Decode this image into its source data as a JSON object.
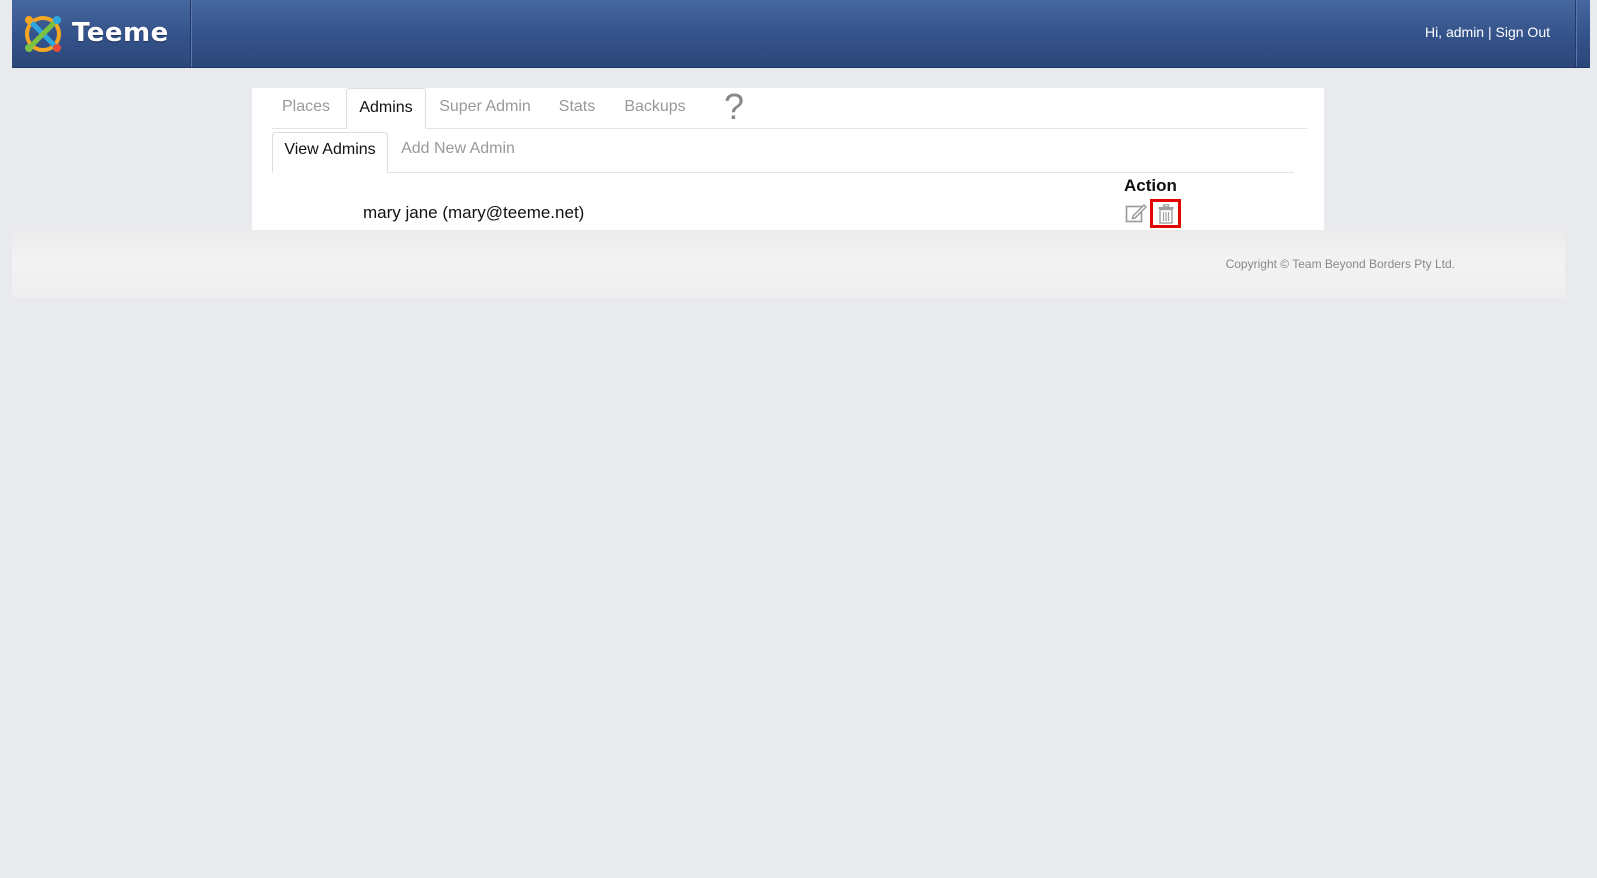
{
  "header": {
    "app_name": "Teeme",
    "greeting": "Hi, admin",
    "separator": "|",
    "sign_out": "Sign Out",
    "colors": {
      "header_bg": "#34528a",
      "header_text": "#ffffff"
    }
  },
  "main_tabs": [
    {
      "label": "Places",
      "active": false
    },
    {
      "label": "Admins",
      "active": true
    },
    {
      "label": "Super Admin",
      "active": false
    },
    {
      "label": "Stats",
      "active": false
    },
    {
      "label": "Backups",
      "active": false
    }
  ],
  "help_glyph": "?",
  "sub_tabs": [
    {
      "label": "View Admins",
      "active": true
    },
    {
      "label": "Add New Admin",
      "active": false
    }
  ],
  "admins_table": {
    "action_header": "Action",
    "rows": [
      {
        "name": "mary jane (mary@teeme.net)",
        "actions": [
          "edit-icon",
          "trash-icon"
        ]
      }
    ],
    "highlight_color": "#e10600"
  },
  "footer": {
    "copyright": "Copyright © Team Beyond Borders Pty Ltd."
  }
}
